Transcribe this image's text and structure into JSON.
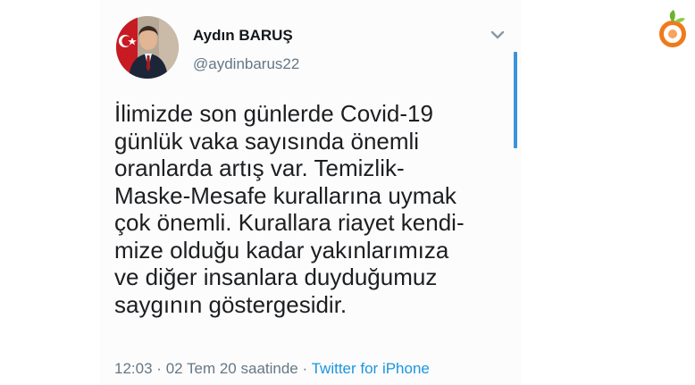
{
  "tweet": {
    "author_name": "Aydın BARUŞ",
    "author_handle": "@aydinbarus22",
    "text_lines": [
      "İlimizde son günlerde Covid-19",
      "günlük vaka sayısında önemli",
      "oranlarda artış var. Temizlik-",
      "Maske-Mesafe kurallarına uymak",
      "çok önemli. Kurallara riayet kendi-",
      "mize olduğu kadar yakınlarımıza",
      "ve diğer insanlara duyduğumuz",
      "saygının göstergesidir."
    ],
    "time": "12:03",
    "separator": "·",
    "date": "02 Tem 20 saatinde",
    "source": "Twitter for iPhone"
  },
  "icons": {
    "more": "chevron-down-icon",
    "logo": "site-logo-icon",
    "flag": "turkish-flag"
  },
  "colors": {
    "name": "#14171a",
    "handle": "#657786",
    "link": "#1b95e0",
    "scrollbar": "#3c93d8",
    "logo_orange": "#f07a1a",
    "logo_green": "#6bb32e"
  }
}
